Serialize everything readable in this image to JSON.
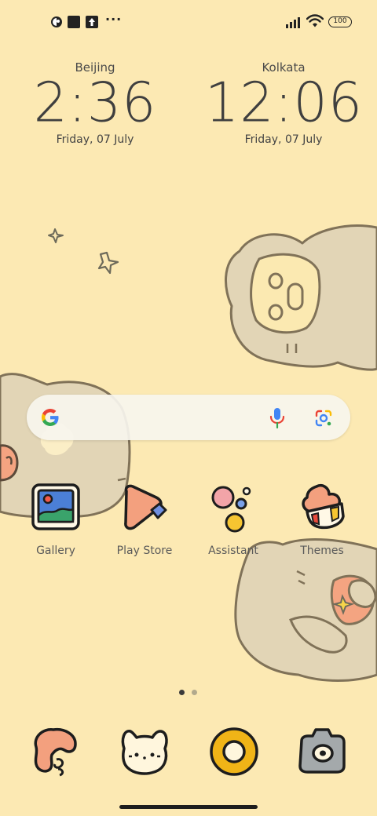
{
  "status_bar": {
    "battery": "100",
    "more_label": "···"
  },
  "clocks": [
    {
      "city": "Beijing",
      "time": "2:36",
      "date": "Friday, 07 July"
    },
    {
      "city": "Kolkata",
      "time": "12:06",
      "date": "Friday, 07 July"
    }
  ],
  "search": {
    "logo_icon": "google-g-icon",
    "mic_icon": "microphone-icon",
    "lens_icon": "google-lens-icon"
  },
  "apps": [
    {
      "label": "Gallery",
      "icon": "gallery-icon"
    },
    {
      "label": "Play Store",
      "icon": "play-store-icon"
    },
    {
      "label": "Assistant",
      "icon": "assistant-icon"
    },
    {
      "label": "Themes",
      "icon": "themes-icon"
    }
  ],
  "page_indicator": {
    "pages": 2,
    "current": 1
  },
  "dock": [
    {
      "name": "phone",
      "icon": "phone-icon"
    },
    {
      "name": "messages",
      "icon": "messages-cat-icon"
    },
    {
      "name": "browser",
      "icon": "browser-ring-icon"
    },
    {
      "name": "camera",
      "icon": "camera-icon"
    }
  ],
  "colors": {
    "background": "#fce9b3",
    "text": "#444444",
    "accent_orange": "#f3a07e",
    "accent_yellow": "#f0b417"
  }
}
